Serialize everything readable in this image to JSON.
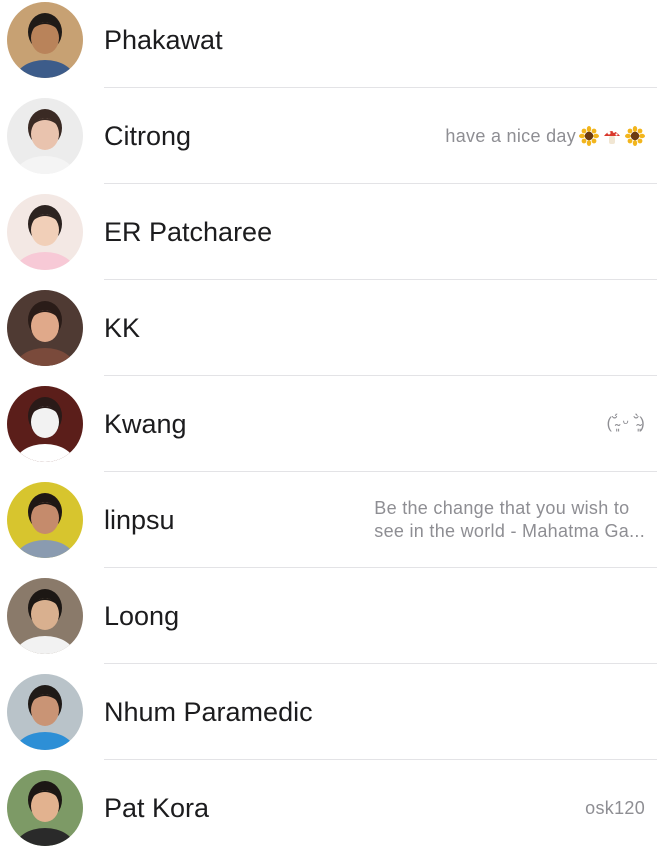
{
  "contacts": [
    {
      "name": "Phakawat",
      "status": "",
      "avatar": {
        "bg": "#c7a173",
        "skin": "#b9835a",
        "hair": "#1f1a17",
        "cloth": "#3d5c8a"
      }
    },
    {
      "name": "Citrong",
      "status": "have a nice day",
      "status_emoji": [
        "sunflower-icon",
        "mushroom-icon",
        "sunflower-icon"
      ],
      "avatar": {
        "bg": "#ececec",
        "skin": "#e9c3ae",
        "hair": "#3a2a24",
        "cloth": "#f4f4f4"
      }
    },
    {
      "name": "ER Patcharee",
      "status": "",
      "avatar": {
        "bg": "#f3e8e4",
        "skin": "#f1cfb8",
        "hair": "#2c2320",
        "cloth": "#f7c9d6"
      }
    },
    {
      "name": "KK",
      "status": "",
      "avatar": {
        "bg": "#4f3a33",
        "skin": "#e0a98a",
        "hair": "#2a1c18",
        "cloth": "#7a4a3b"
      }
    },
    {
      "name": "Kwang",
      "status": "(˘̴͈́ ᵕ ˘̴͈̀)",
      "avatar": {
        "bg": "#5b1e1a",
        "skin": "#f2f2f2",
        "hair": "#2a1a18",
        "cloth": "#ffffff"
      }
    },
    {
      "name": "linpsu",
      "status_lines": [
        "Be the change that you wish to",
        "see in the world - Mahatma Ga..."
      ],
      "avatar": {
        "bg": "#d7c52e",
        "skin": "#c58b6c",
        "hair": "#1f1714",
        "cloth": "#8a9bb0"
      }
    },
    {
      "name": "Loong",
      "status": "",
      "avatar": {
        "bg": "#8a7a6a",
        "skin": "#d9b08f",
        "hair": "#1c1714",
        "cloth": "#f2f2f2"
      }
    },
    {
      "name": "Nhum Paramedic",
      "status": "",
      "avatar": {
        "bg": "#b9c3c9",
        "skin": "#c99475",
        "hair": "#1f1a17",
        "cloth": "#2d8fd6"
      }
    },
    {
      "name": "Pat Kora",
      "status": "osk120",
      "avatar": {
        "bg": "#7d9a66",
        "skin": "#e2b28f",
        "hair": "#1c1714",
        "cloth": "#2a2a2a"
      }
    }
  ],
  "colors": {
    "name_text": "#1c1c1e",
    "status_text": "#8e8e93",
    "divider": "#e3e3e6"
  }
}
